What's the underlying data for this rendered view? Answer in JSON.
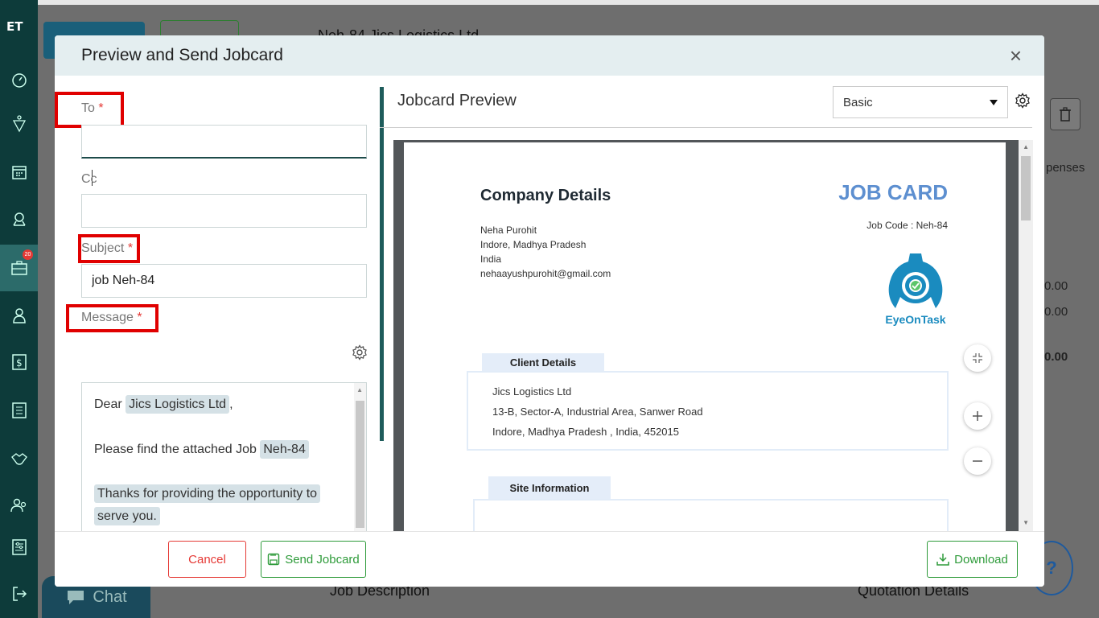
{
  "sidebar": {
    "logo": "ET",
    "icons": [
      "dashboard-icon",
      "funnel-icon",
      "calendar-icon",
      "map-pin-icon",
      "briefcase-icon",
      "user-icon",
      "invoice-icon",
      "list-icon",
      "handshake-icon",
      "team-icon",
      "settings-list-icon",
      "logout-icon"
    ],
    "badge_count": "20"
  },
  "background": {
    "title": "Neh-84 Jics Logistics Ltd",
    "right_tab": "penses",
    "amount_1": "0.00",
    "amount_2": "0.00",
    "amount_3": "0.00",
    "job_description": "Job Description",
    "quotation_details": "Quotation Details",
    "chat_label": "Chat",
    "help_label": "?"
  },
  "modal": {
    "title": "Preview and Send Jobcard",
    "close": "×",
    "to_label": "To",
    "cc_label": "Cc",
    "subject_label": "Subject",
    "message_label": "Message",
    "required_mark": "*",
    "to_value": "",
    "cc_value": "",
    "subject_value": "job Neh-84",
    "message": {
      "greeting": "Dear",
      "client_name": "Jics Logistics Ltd",
      "greeting_end": ",",
      "line2": "Please find the attached Job",
      "job_code": "Neh-84",
      "line3a": "Thanks for providing the opportunity to",
      "line3b": "serve you."
    },
    "cancel_label": "Cancel",
    "send_label": "Send Jobcard",
    "download_label": "Download"
  },
  "preview": {
    "title": "Jobcard Preview",
    "template_selected": "Basic",
    "document": {
      "company_heading": "Company Details",
      "job_card_title": "JOB CARD",
      "job_code": "Job Code : Neh-84",
      "company_lines": [
        "Neha Purohit",
        "Indore, Madhya Pradesh",
        "India",
        "nehaayushpurohit@gmail.com"
      ],
      "logo_text": "EyeOnTask",
      "client_section": "Client Details",
      "client_lines": [
        "Jics Logistics Ltd",
        "13-B, Sector-A, Industrial Area, Sanwer Road",
        "Indore, Madhya Pradesh , India, 452015"
      ],
      "site_section": "Site Information"
    }
  },
  "colors": {
    "sidebar": "#0d3b3a",
    "accent_green": "#2e9b3a",
    "danger": "#e53935",
    "job_card_blue": "#5d8fd0"
  }
}
